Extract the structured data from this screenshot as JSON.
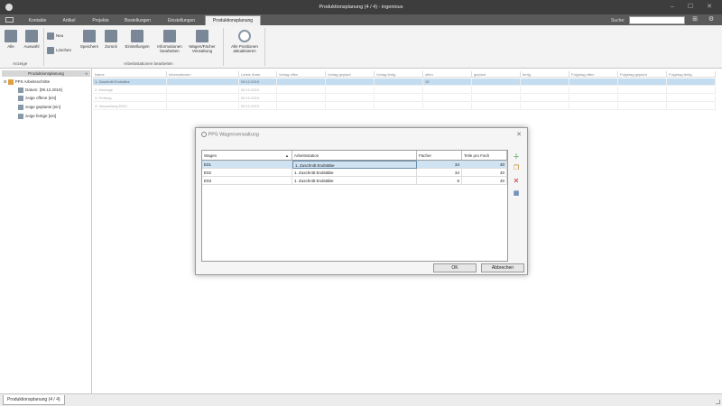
{
  "window": {
    "title": "Produktionsplanung (4 / 4) - ingenious",
    "minimize": "–",
    "maximize": "☐",
    "close": "✕"
  },
  "menu": {
    "tabs": [
      "Kontakte",
      "Artikel",
      "Projekte",
      "Bestellungen",
      "Einstellungen",
      "Produktionsplanung"
    ],
    "search_label": "Suche:",
    "search_value": ""
  },
  "ribbon": {
    "anzeige": {
      "alle": "Alle",
      "auswahl": "Auswahl",
      "group": "Anzeige"
    },
    "neu": "Neu",
    "loeschen": "Löschen",
    "speichern": "Speichern",
    "zurueck": "Zurück",
    "einstellungen": "Einstellungen",
    "informationen": [
      "Informationen",
      "bearbeiten"
    ],
    "wagen": [
      "Wagen/Fächer",
      "Verwaltung"
    ],
    "group_arbeitsstationen": "Arbeitsstationen bearbeiten",
    "alle_positionen": [
      "Alle Positionen",
      "aktualisieren"
    ]
  },
  "left_panel": {
    "header": "Produktionsplanung",
    "collapse": "«",
    "root": "PPS Arbeitsschritte",
    "items": [
      "Datum: [09.12.2019]",
      "zeige offene [ein]",
      "zeige geplante [ein]",
      "zeige fertige [ein]"
    ]
  },
  "grid": {
    "columns": [
      "Name",
      "Informationen",
      "Letzte Ände",
      "Vorlag offen",
      "Vorlag geplant",
      "Vorlag fertig",
      "offen",
      "geplant",
      "fertig",
      "Folgetag offen",
      "Folgetag geplant",
      "Folgetag fertig"
    ],
    "rows": [
      [
        "1. Zuschnitt Endstäbe",
        "",
        "09.12.2019",
        "",
        "",
        "",
        "19",
        "",
        "",
        "",
        "",
        ""
      ],
      [
        "2. Montage",
        "",
        "09.12.2019",
        "",
        "",
        "",
        "",
        "",
        "",
        "",
        "",
        ""
      ],
      [
        "3. Prüfung",
        "",
        "09.12.2019",
        "",
        "",
        "",
        "",
        "",
        "",
        "",
        "",
        ""
      ],
      [
        "4. Verpackung EDI3",
        "",
        "09.12.2019",
        "",
        "",
        "",
        "",
        "",
        "",
        "",
        "",
        ""
      ]
    ]
  },
  "dialog": {
    "title": "PPS Wagenverwaltung",
    "close": "✕",
    "columns": [
      "Wagen",
      "Arbeitsstation",
      "Fächer",
      "Teile pro Fach"
    ],
    "rows": [
      [
        "E01",
        "1. Zuschnitt Endstäbe",
        "34",
        "40"
      ],
      [
        "E02",
        "1. Zuschnitt Endstäbe",
        "34",
        "40"
      ],
      [
        "E03",
        "1. Zuschnitt Endstäbe",
        "5",
        "40"
      ]
    ],
    "ok": "OK",
    "cancel": "Abbrechen"
  },
  "status": {
    "tab": "Produktionsplanung (4 / 4)"
  },
  "colors": {
    "selection": "#c3dcef",
    "titlebar": "#3d3d3d",
    "menubar": "#5a5a5a"
  }
}
